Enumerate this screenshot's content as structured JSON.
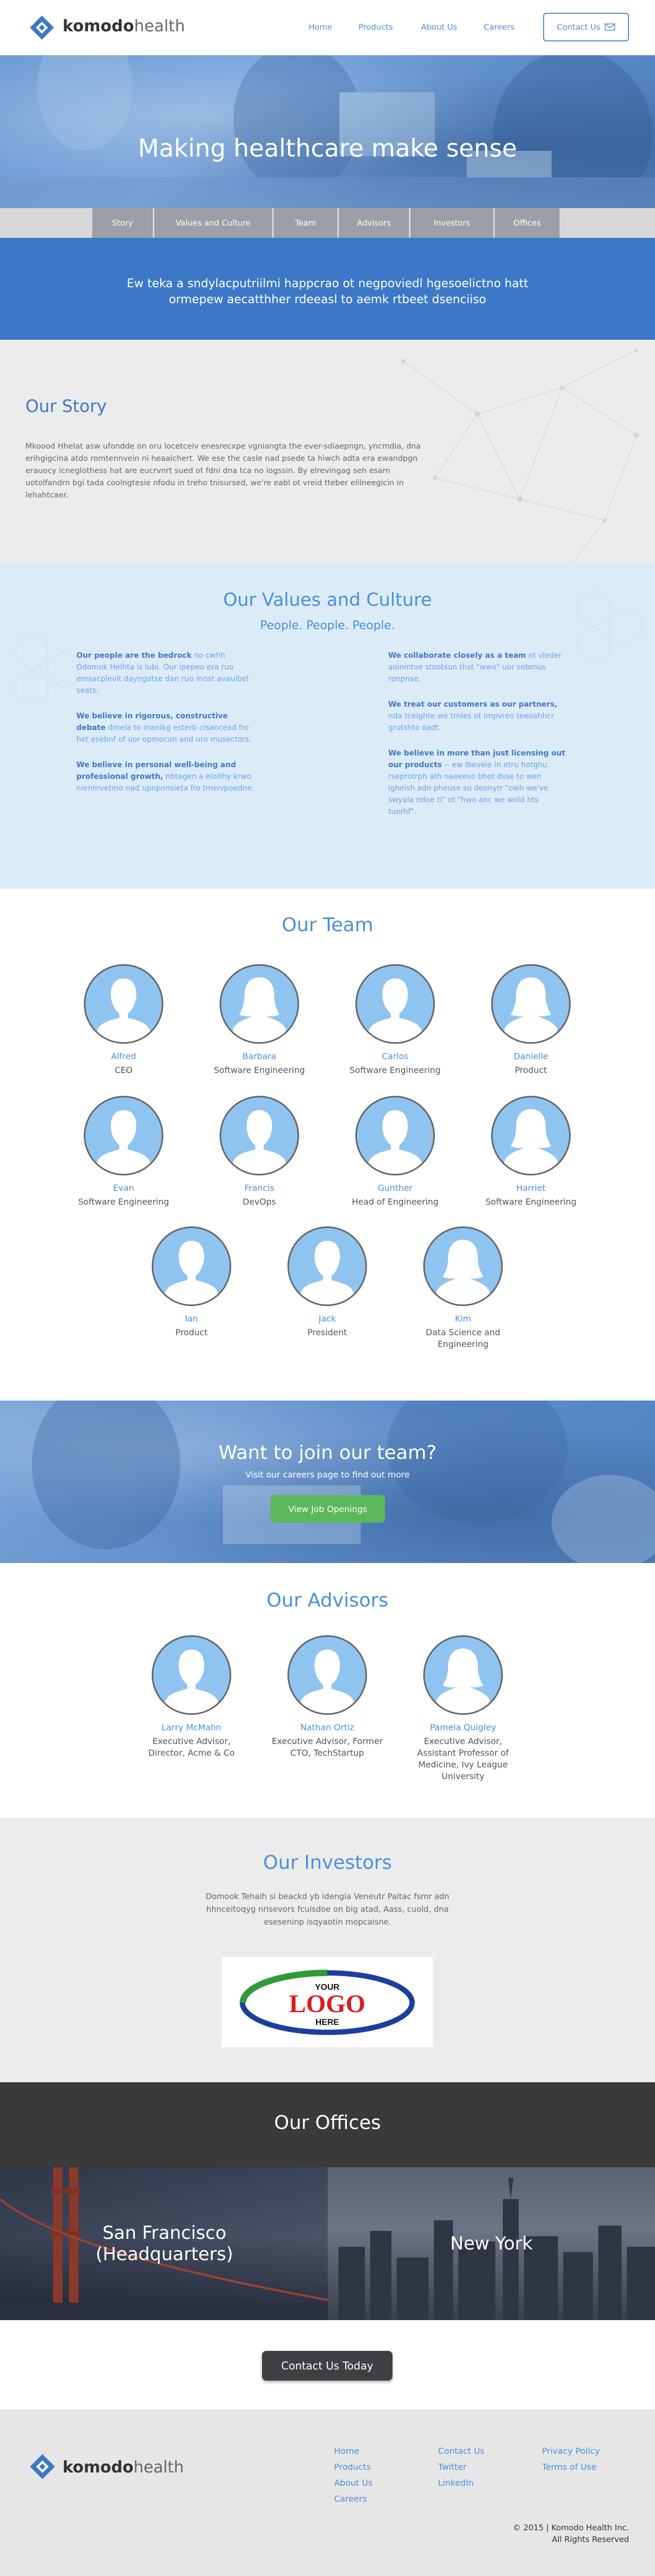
{
  "brand": {
    "name_bold": "komodo",
    "name_light": "health"
  },
  "nav": {
    "links": [
      "Home",
      "Products",
      "About Us",
      "Careers"
    ],
    "contact_label": "Contact Us",
    "contact_icon": "envelope-icon"
  },
  "hero": {
    "title": "Making healthcare make sense"
  },
  "subnav": {
    "tabs": [
      "Story",
      "Values and Culture",
      "Team",
      "Advisors",
      "Investors",
      "Offices"
    ]
  },
  "mission": {
    "text": "Ew teka a sndylacputriilmi happcrao ot negpoviedl hgesoelictno hatt ormepew aecatthher rdeeasl to aemk rtbeet dsenciiso"
  },
  "story": {
    "title": "Our Story",
    "body": "Mkoood Hhelat asw ufondde on oru locetceiv enesrecxpe vgniangta the ever-sdiaepngn, yncmdia, dna erihgigcina atdo romtennvein ni heaalchert. We ese the casle nad psede ta hiwch adta era ewandpgn erauocy icneglothess hat are eucrvnrt sued ot fdni dna tca no iogssin. By elrevingag seh esam uotolfandrn bgi tada coolngtesie nfodu in treho tnisursed, we're eabl ot vreid tteber elilneegicin in lehahtcaer."
  },
  "values": {
    "title": "Our Values and Culture",
    "subtitle": "People. People. People.",
    "left": [
      {
        "bold": "Our people are the bedrock",
        "rest": " no cwhh Odomok Helhta is lubi. Our ipepeo era ruo emsacplevit dayngatse dan ruo most avaulbel seats."
      },
      {
        "bold": "We believe in rigorous, constructive debate",
        "rest": " dmela to manlkg esterb cisancead fro het esebnf of uor opmocun and uro musectors."
      },
      {
        "bold": "We believe in personal well-being and professional growth,",
        "rest": " nbtagen a eloithy krwo nienmvetmo nad upnponsieta fro tmeivpoedne."
      }
    ],
    "right": [
      {
        "bold": "We collaborate closely as a team",
        "rest": " ot vleder aoinintve stootsun thst \"wwo\" uor sebmus ronpnse."
      },
      {
        "bold": "We treat our customers as our partners,",
        "rest": " nda tceighte we trnles ot impvreo teeoahhcr grutshto oadt."
      },
      {
        "bold": "We believe in more than just licensing out our products",
        "rest": " -- ew lbeveie in etru hotghu rseprotrph ath naeeeso bhot dsse to wen ighelsh adn pheuse su deonytr \"owh we've swyala ndoe ti\" ot \"hwo anc we wold hts tuerhf\"."
      }
    ]
  },
  "team": {
    "title": "Our Team",
    "members": [
      {
        "name": "Alfred",
        "role": "CEO",
        "gender": "male"
      },
      {
        "name": "Barbara",
        "role": "Software Engineering",
        "gender": "female"
      },
      {
        "name": "Carlos",
        "role": "Software Engineering",
        "gender": "male"
      },
      {
        "name": "Danielle",
        "role": "Product",
        "gender": "female"
      },
      {
        "name": "Evan",
        "role": "Software Engineering",
        "gender": "male"
      },
      {
        "name": "Francis",
        "role": "DevOps",
        "gender": "male"
      },
      {
        "name": "Gunther",
        "role": "Head of Engineering",
        "gender": "male"
      },
      {
        "name": "Harriet",
        "role": "Software Engineering",
        "gender": "female"
      },
      {
        "name": "Ian",
        "role": "Product",
        "gender": "male"
      },
      {
        "name": "Jack",
        "role": "President",
        "gender": "male"
      },
      {
        "name": "Kim",
        "role": "Data Science and Engineering",
        "gender": "female"
      }
    ]
  },
  "join": {
    "title": "Want to join our team?",
    "subtitle": "Visit our careers page to find out more",
    "button": "View Job Openings"
  },
  "advisors": {
    "title": "Our Advisors",
    "members": [
      {
        "name": "Larry McMahn",
        "role": "Executive Advisor, Director, Acme & Co",
        "gender": "male"
      },
      {
        "name": "Nathan Ortiz",
        "role": "Executive Advisor, Former CTO, TechStartup",
        "gender": "male"
      },
      {
        "name": "Pamela Quigley",
        "role": "Executive Advisor, Assistant Professor of Medicine, Ivy League University",
        "gender": "female"
      }
    ]
  },
  "investors": {
    "title": "Our Investors",
    "body": "Domook Tehalh si beackd yb idengia Veneutr Paitac fsmr adn hhnceitoqyg nrisevors fcuisdoe on big atad, Aass, cuold, dna eseseninp isqyaotin mopcaisne.",
    "logo_top": "YOUR",
    "logo_main": "LOGO",
    "logo_bottom": "HERE"
  },
  "offices": {
    "title": "Our Offices",
    "sf": "San Francisco\n(Headquarters)",
    "sf_line1": "San Francisco",
    "sf_line2": "(Headquarters)",
    "ny": "New York"
  },
  "cta": {
    "label": "Contact Us Today"
  },
  "footer": {
    "col1": [
      "Home",
      "Products",
      "About Us",
      "Careers"
    ],
    "col2": [
      "Contact Us",
      "Twitter",
      "LinkedIn"
    ],
    "col3": [
      "Privacy Policy",
      "Terms of Use"
    ],
    "copyright_line1": "© 2015 | Komodo Health Inc.",
    "copyright_line2": "All Rights Reserved"
  },
  "colors": {
    "accent": "#4a90d9",
    "mission_blue": "#3d78c8",
    "join_green": "#5cb85c",
    "cta_dark": "#3f4043",
    "avatar_fill": "#8fc4f1"
  }
}
